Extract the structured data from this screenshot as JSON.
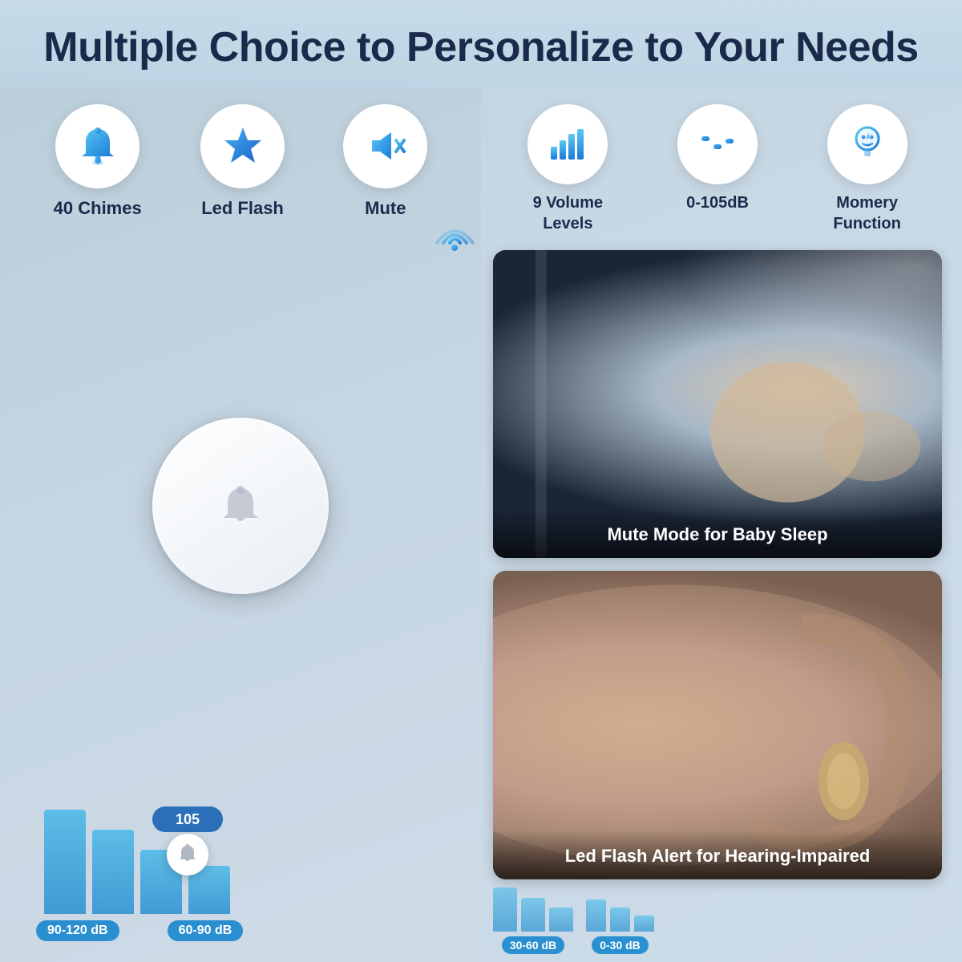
{
  "header": {
    "title": "Multiple Choice to Personalize to Your Needs"
  },
  "left_features": [
    {
      "id": "chimes",
      "label": "40 Chimes",
      "icon": "bell"
    },
    {
      "id": "led_flash",
      "label": "Led Flash",
      "icon": "star"
    },
    {
      "id": "mute",
      "label": "Mute",
      "icon": "mute"
    }
  ],
  "right_features": [
    {
      "id": "volume",
      "label": "9 Volume\nLevels",
      "icon": "bars"
    },
    {
      "id": "db_range",
      "label": "0-105dB",
      "icon": "equalizer"
    },
    {
      "id": "memory",
      "label": "Momery\nFunction",
      "icon": "memory"
    }
  ],
  "photo_cards": [
    {
      "id": "baby",
      "label": "Mute Mode for Baby Sleep"
    },
    {
      "id": "hearing",
      "label": "Led Flash Alert for Hearing-Impaired"
    }
  ],
  "volume_indicator": "105",
  "db_ranges_left": [
    {
      "label": "90-120 dB"
    },
    {
      "label": "60-90 dB"
    }
  ],
  "db_ranges_right": [
    {
      "label": "30-60 dB"
    },
    {
      "label": "0-30 dB"
    }
  ]
}
